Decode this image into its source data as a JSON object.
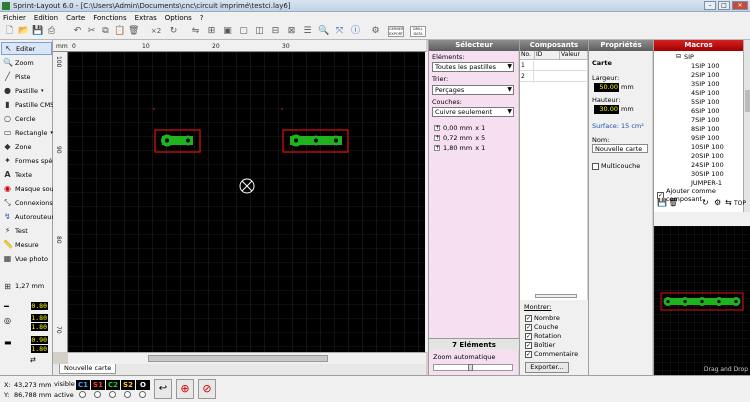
{
  "window": {
    "title": "Sprint-Layout 6.0 - [C:\\Users\\Admin\\Documents\\cnc\\circuit imprimé\\testci.lay6]",
    "min": "–",
    "max": "□",
    "close": "✕"
  },
  "menu": [
    "Fichier",
    "Edition",
    "Carte",
    "Fonctions",
    "Extras",
    "Options",
    "?"
  ],
  "toolbar": {
    "zoom_label": "×2",
    "gerber_label": "GERBER EXPORT",
    "drill_label": "DRILL DATA"
  },
  "tools": [
    {
      "label": "Editer",
      "icon": "cursor-icon"
    },
    {
      "label": "Zoom",
      "icon": "zoom-icon"
    },
    {
      "label": "Piste",
      "icon": "track-icon"
    },
    {
      "label": "Pastille",
      "icon": "pad-icon"
    },
    {
      "label": "Pastille CMS",
      "icon": "smd-pad-icon"
    },
    {
      "label": "Cercle",
      "icon": "circle-icon"
    },
    {
      "label": "Rectangle",
      "icon": "rectangle-icon"
    },
    {
      "label": "Zone",
      "icon": "zone-icon"
    },
    {
      "label": "Formes spéc.",
      "icon": "shape-icon"
    },
    {
      "label": "Texte",
      "icon": "text-icon"
    },
    {
      "label": "Masque soud.",
      "icon": "mask-icon"
    },
    {
      "label": "Connexions",
      "icon": "connection-icon"
    },
    {
      "label": "Autorouteur",
      "icon": "autoroute-icon"
    },
    {
      "label": "Test",
      "icon": "test-icon"
    },
    {
      "label": "Mesure",
      "icon": "measure-icon"
    },
    {
      "label": "Vue photo",
      "icon": "photo-icon"
    }
  ],
  "grid_label": "1,27 mm",
  "widths": {
    "track": "0.80",
    "pad_outer": "1.80",
    "pad_inner": "1.80",
    "smd_w": "0.90",
    "smd_h": "1.80"
  },
  "ruler": {
    "unit": "mm",
    "top": [
      "0",
      "10",
      "20",
      "30"
    ],
    "left": [
      "100",
      "90",
      "80",
      "70"
    ]
  },
  "tab_name": "Nouvelle carte",
  "selector": {
    "header": "Sélecteur",
    "elements_label": "Eléments:",
    "elements_value": "Toutes les pastilles",
    "sort_label": "Trier:",
    "sort_value": "Perçages",
    "layers_label": "Couches:",
    "layers_value": "Cuivre seulement",
    "rows": [
      {
        "size": "0,00 mm",
        "count": "x 1"
      },
      {
        "size": "0,72 mm",
        "count": "x 5"
      },
      {
        "size": "1,80 mm",
        "count": "x 1"
      }
    ],
    "footer": "7 Eléments",
    "zoom_label": "Zoom automatique"
  },
  "composants": {
    "header": "Composants",
    "columns": [
      "No.",
      "ID",
      "Valeur"
    ],
    "rows": [
      "1",
      "2"
    ],
    "show_label": "Montrer:",
    "options": [
      "Nombre",
      "Couche",
      "Rotation",
      "Boîtier",
      "Commentaire"
    ],
    "export_button": "Exporter..."
  },
  "props": {
    "header": "Propriétés",
    "section": "Carte",
    "width_label": "Largeur:",
    "width_value": "50.00",
    "height_label": "Hauteur:",
    "height_value": "30.00",
    "unit": "mm",
    "surface": "Surface: 15 cm²",
    "name_label": "Nom:",
    "name_value": "Nouvelle carte",
    "multilayer": "Multicouche"
  },
  "macros": {
    "header": "Macros",
    "root": "SIP",
    "items": [
      "1SIP 100",
      "2SIP 100",
      "3SIP 100",
      "4SIP 100",
      "5SIP 100",
      "6SIP 100",
      "7SIP 100",
      "8SIP 100",
      "9SIP 100",
      "10SIP 100",
      "20SIP 100",
      "24SIP 100",
      "30SIP 100",
      "JUMPER-1"
    ],
    "add_component": "Ajouter comme composant",
    "top_label": "TOP",
    "dragdrop": "Drag and Drop"
  },
  "status": {
    "x_label": "X:",
    "x_value": "43,273 mm",
    "y_label": "Y:",
    "y_value": "86,788 mm",
    "visible": "visible",
    "active": "active",
    "layers": [
      {
        "label": "C1",
        "color": "#4aa3ff"
      },
      {
        "label": "S1",
        "color": "#ff3b3b"
      },
      {
        "label": "C2",
        "color": "#22d022"
      },
      {
        "label": "S2",
        "color": "#ffd21e"
      },
      {
        "label": "O",
        "color": "#ffffff"
      }
    ]
  },
  "colors": {
    "pad": "#1fb31f",
    "outline": "#e01010",
    "grid": "#3a3a3a"
  }
}
